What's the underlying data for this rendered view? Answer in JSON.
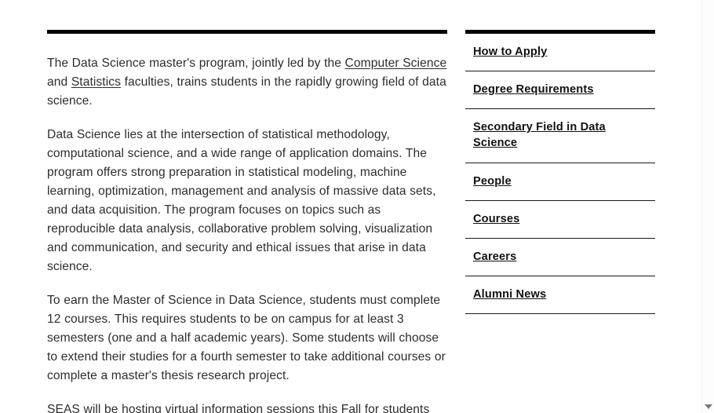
{
  "main": {
    "paragraphs": [
      {
        "id": "intro",
        "segments": [
          {
            "type": "text",
            "value": "The Data Science master's program, jointly led by the "
          },
          {
            "type": "link",
            "value": "Computer Science"
          },
          {
            "type": "text",
            "value": " and "
          },
          {
            "type": "link",
            "value": "Statistics"
          },
          {
            "type": "text",
            "value": " faculties, trains students in the rapidly growing field of data science."
          }
        ]
      },
      {
        "id": "intersection",
        "segments": [
          {
            "type": "text",
            "value": "Data Science lies at the intersection of statistical methodology, computational science, and a wide range of application domains.  The program offers strong preparation in statistical modeling, machine learning, optimization, management and analysis of massive data sets, and data acquisition.  The program focuses on topics such as reproducible data analysis, collaborative problem solving, visualization and communication, and security and ethical issues that arise in data science."
          }
        ]
      },
      {
        "id": "requirements",
        "segments": [
          {
            "type": "text",
            "value": "To earn the Master of Science in Data Science, students must complete 12 courses. This requires students to be on campus for at least 3 semesters (one and a half academic years). Some students will choose to extend their studies for a fourth semester to take additional courses or complete a master's thesis research project."
          }
        ]
      },
      {
        "id": "info-sessions",
        "segments": [
          {
            "type": "text",
            "value": "SEAS will be hosting virtual information sessions this Fall for students"
          }
        ]
      }
    ]
  },
  "sidebar": {
    "items": [
      {
        "label": "How to Apply"
      },
      {
        "label": "Degree Requirements"
      },
      {
        "label": "Secondary Field in Data Science"
      },
      {
        "label": "People"
      },
      {
        "label": "Courses"
      },
      {
        "label": "Careers"
      },
      {
        "label": "Alumni News"
      }
    ]
  },
  "colors": {
    "rule": "#000000",
    "text": "#2d2d2d",
    "nav_text": "#111111",
    "divider": "#1a1a1a",
    "scroll_arrow": "#7a7a7a"
  },
  "icons": {
    "scroll_down_arrow": "chevron-down-icon"
  }
}
